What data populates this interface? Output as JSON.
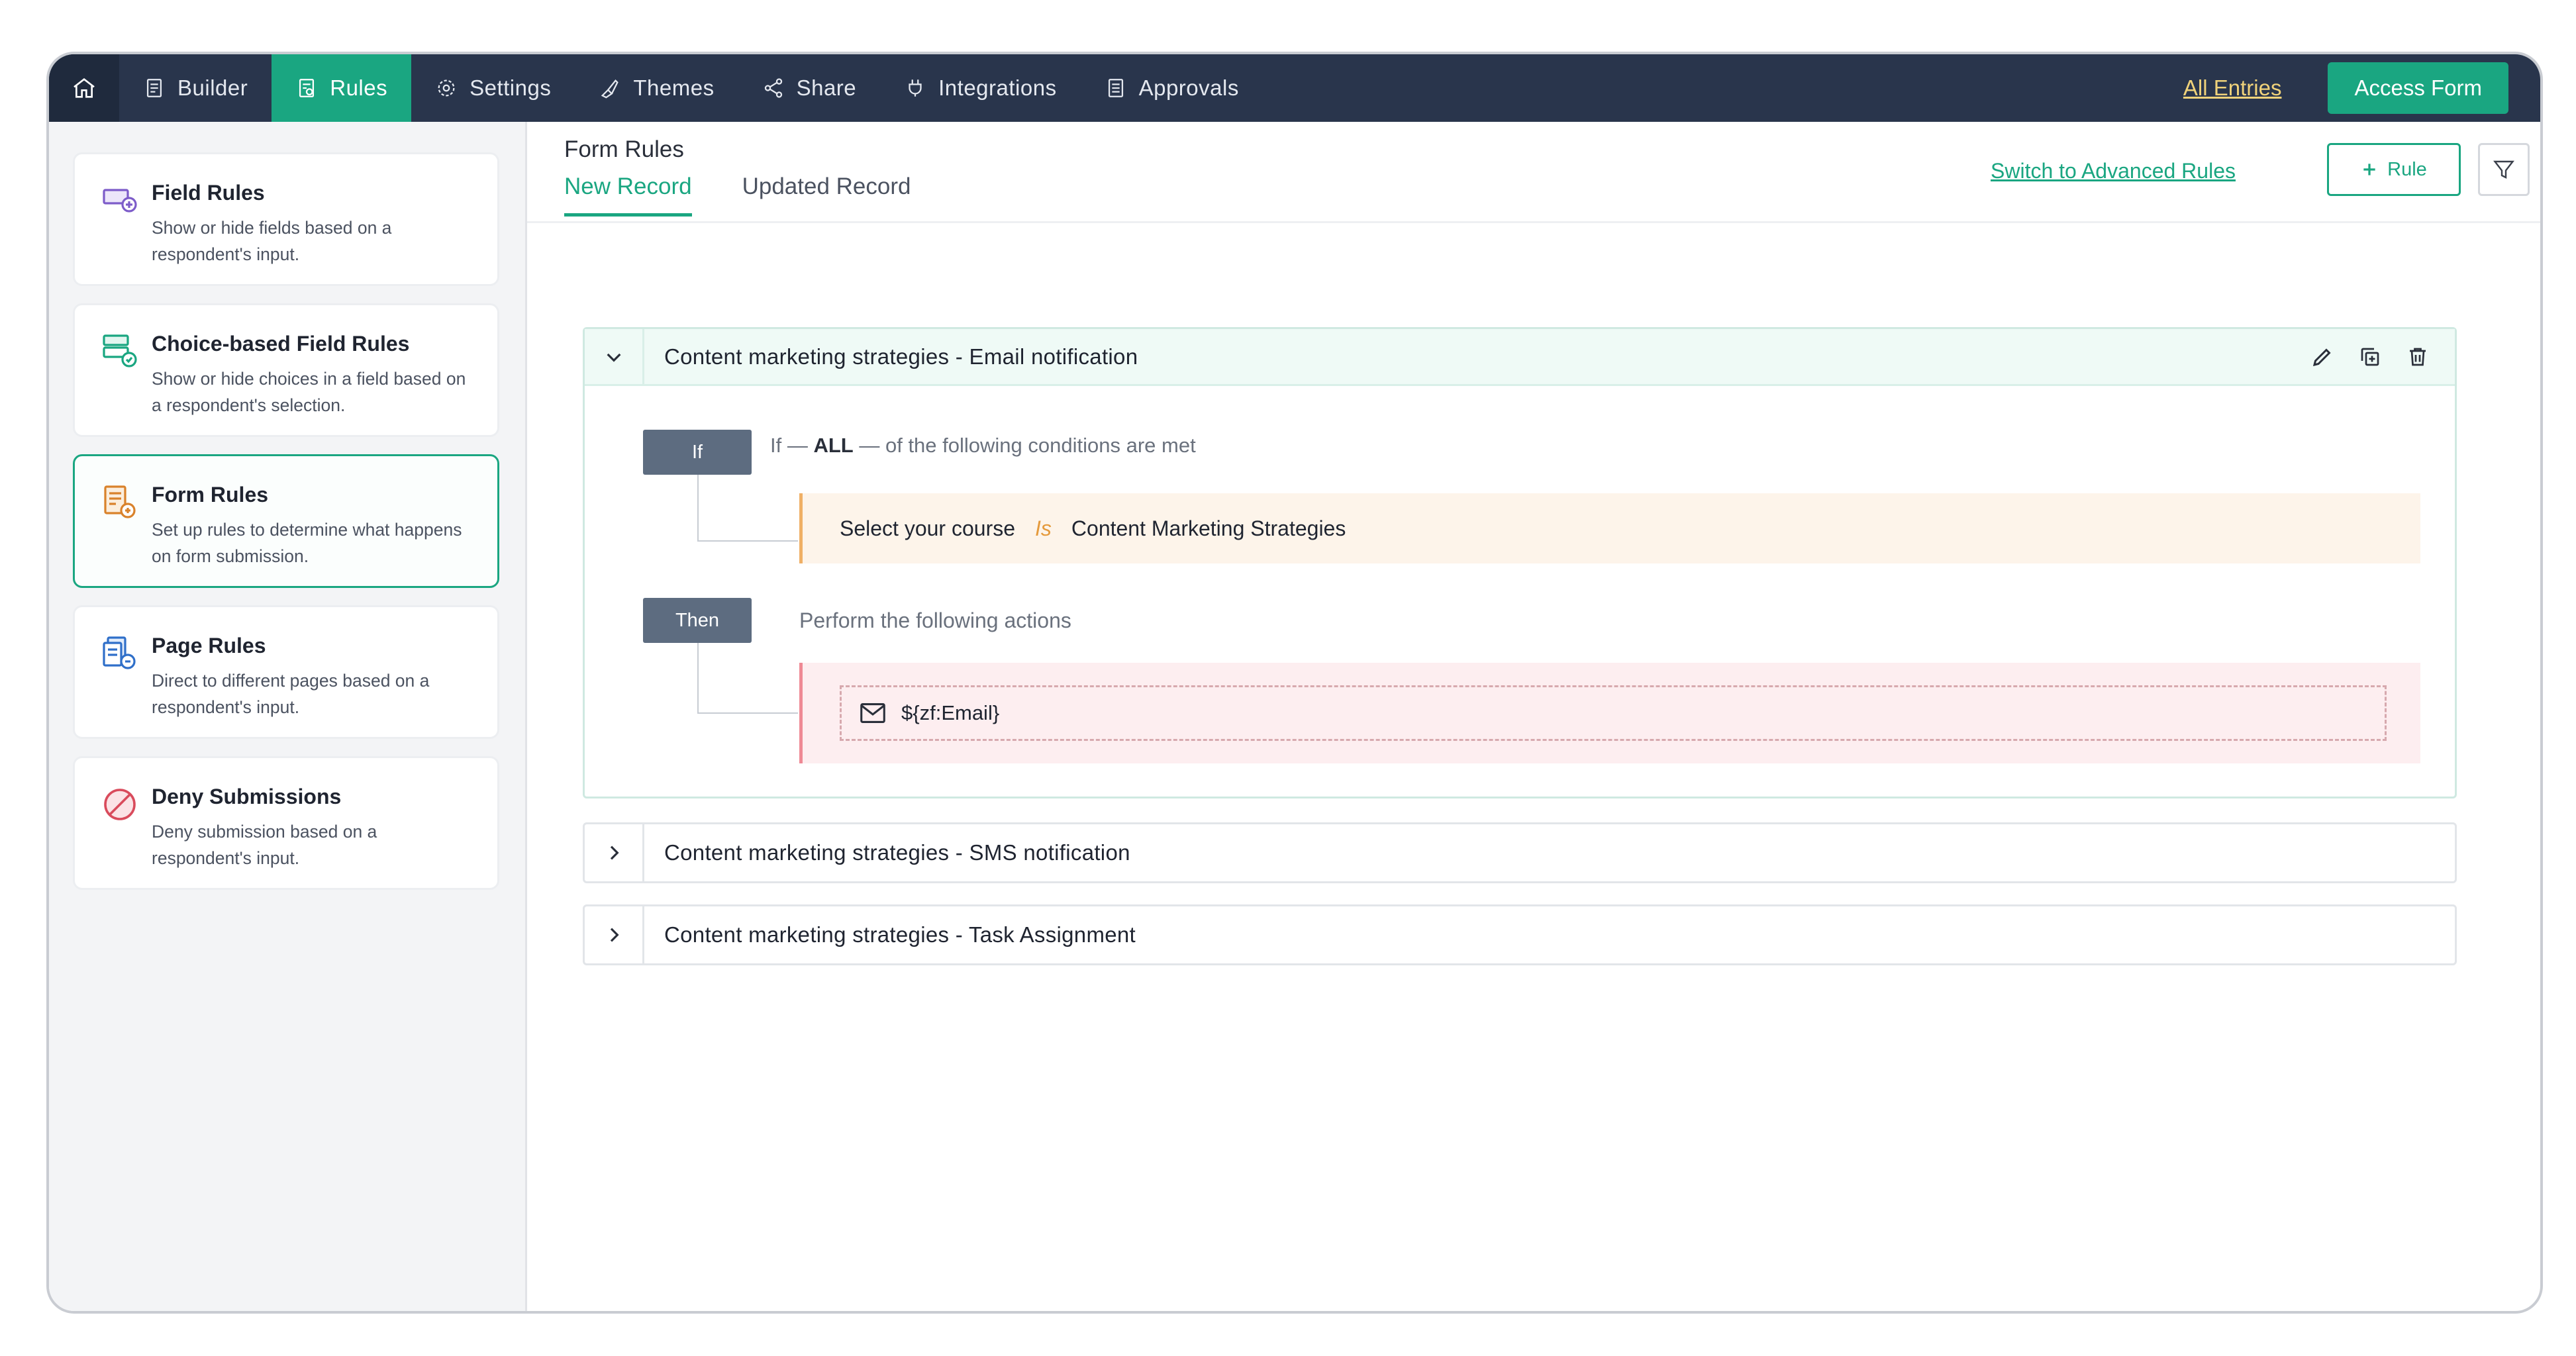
{
  "nav": {
    "items": [
      {
        "label": "Builder",
        "icon": "builder-icon"
      },
      {
        "label": "Rules",
        "icon": "rules-icon",
        "active": true
      },
      {
        "label": "Settings",
        "icon": "gear-icon"
      },
      {
        "label": "Themes",
        "icon": "brush-icon"
      },
      {
        "label": "Share",
        "icon": "share-icon"
      },
      {
        "label": "Integrations",
        "icon": "plug-icon"
      },
      {
        "label": "Approvals",
        "icon": "approvals-icon"
      }
    ],
    "all_entries": "All Entries",
    "access_form": "Access Form"
  },
  "sidebar": {
    "cards": [
      {
        "title": "Field Rules",
        "desc": "Show or hide fields based on a respondent's input."
      },
      {
        "title": "Choice-based Field Rules",
        "desc": "Show or hide choices in a field based on a respondent's selection."
      },
      {
        "title": "Form Rules",
        "desc": "Set up rules to determine what happens on form submission.",
        "active": true
      },
      {
        "title": "Page Rules",
        "desc": "Direct to different pages based on a respondent's input."
      },
      {
        "title": "Deny Submissions",
        "desc": "Deny submission based on a respondent's input."
      }
    ]
  },
  "main": {
    "title": "Form Rules",
    "tabs": [
      {
        "label": "New Record",
        "active": true
      },
      {
        "label": "Updated Record"
      }
    ],
    "advanced_link": "Switch to Advanced Rules",
    "add_rule_label": "Rule",
    "rules": [
      {
        "title": "Content marketing strategies - Email notification",
        "expanded": true,
        "if_tag": "If",
        "cond_prefix": "If —",
        "cond_match": "ALL",
        "cond_suffix": "— of the following conditions are met",
        "condition": {
          "field": "Select your course",
          "operator": "Is",
          "value": "Content Marketing Strategies"
        },
        "then_tag": "Then",
        "actions_label": "Perform the following actions",
        "action_value": "${zf:Email}"
      },
      {
        "title": "Content marketing strategies - SMS notification",
        "expanded": false
      },
      {
        "title": "Content marketing strategies - Task Assignment",
        "expanded": false
      }
    ]
  },
  "colors": {
    "accent": "#1aa681",
    "nav_bg": "#29354c",
    "cond_bg": "#fdf4ea",
    "action_bg": "#fdeef0"
  }
}
